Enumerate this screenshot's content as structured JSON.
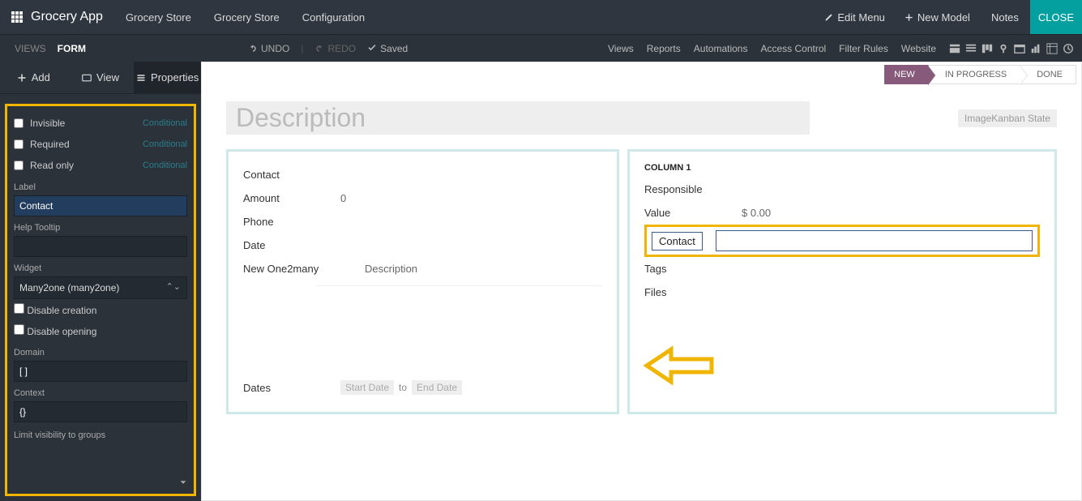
{
  "topbar": {
    "app_name": "Grocery App",
    "menus": [
      "Grocery Store",
      "Grocery Store",
      "Configuration"
    ],
    "edit_menu": "Edit Menu",
    "new_model": "New Model",
    "notes": "Notes",
    "close": "CLOSE"
  },
  "secondbar": {
    "views_label": "VIEWS",
    "form_label": "FORM",
    "undo": "UNDO",
    "redo": "REDO",
    "saved": "Saved",
    "links": [
      "Views",
      "Reports",
      "Automations",
      "Access Control",
      "Filter Rules",
      "Website"
    ]
  },
  "sidepanel": {
    "tabs": {
      "add": "Add",
      "view": "View",
      "properties": "Properties"
    },
    "invisible": "Invisible",
    "required": "Required",
    "readonly": "Read only",
    "conditional": "Conditional",
    "label_lbl": "Label",
    "label_val": "Contact",
    "help_lbl": "Help Tooltip",
    "help_val": "",
    "widget_lbl": "Widget",
    "widget_val": "Many2one (many2one)",
    "disable_creation": "Disable creation",
    "disable_opening": "Disable opening",
    "domain_lbl": "Domain",
    "domain_val": "[ ]",
    "context_lbl": "Context",
    "context_val": "{}",
    "limit_lbl": "Limit visibility to groups"
  },
  "canvas": {
    "status": {
      "new": "NEW",
      "in_progress": "IN PROGRESS",
      "done": "DONE"
    },
    "title": "Description",
    "img_placeholder": "ImageKanban State",
    "left_col": {
      "contact": "Contact",
      "amount": "Amount",
      "amount_val": "0",
      "phone": "Phone",
      "date": "Date",
      "new_o2m": "New One2many",
      "o2m_head": "Description",
      "dates": "Dates",
      "start": "Start Date",
      "to": "to",
      "end": "End Date"
    },
    "right_col": {
      "header": "COLUMN 1",
      "responsible": "Responsible",
      "value": "Value",
      "value_val": "$ 0.00",
      "contact": "Contact",
      "tags": "Tags",
      "files": "Files"
    }
  }
}
